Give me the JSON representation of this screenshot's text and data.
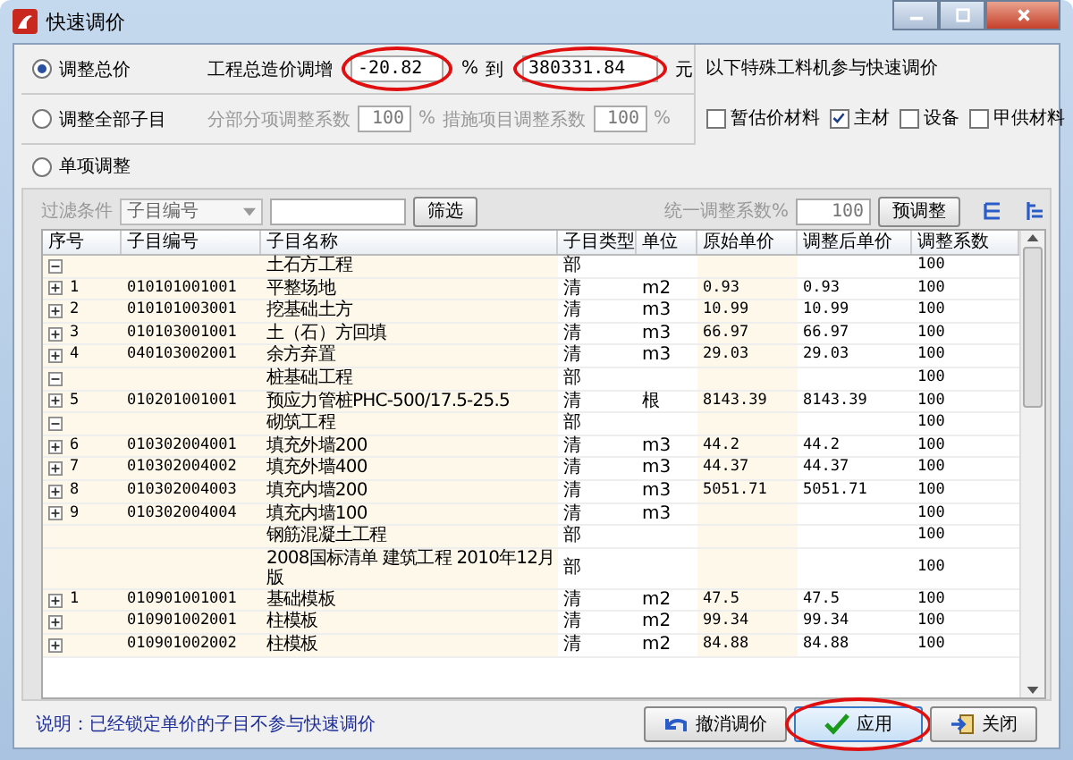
{
  "window": {
    "title": "快速调价"
  },
  "adjust_modes": [
    {
      "label": "调整总价",
      "selected": true
    },
    {
      "label": "调整全部子目",
      "selected": false
    },
    {
      "label": "单项调整",
      "selected": false
    }
  ],
  "total_adjust": {
    "label": "工程总造价调增",
    "percent": "-20.82",
    "percent_circled": true,
    "percent_unit": "%",
    "to_label": "到",
    "amount": "380331.84",
    "amount_circled": true,
    "amount_unit": "元"
  },
  "coef": {
    "disabled": true,
    "fenbu_label": "分部分项调整系数",
    "fenbu_value": "100",
    "fenbu_unit": "%",
    "cuoshi_label": "措施项目调整系数",
    "cuoshi_value": "100",
    "cuoshi_unit": "%"
  },
  "special": {
    "title": "以下特殊工料机参与快速调价",
    "options": [
      {
        "label": "暂估价材料",
        "checked": false
      },
      {
        "label": "主材",
        "checked": true
      },
      {
        "label": "设备",
        "checked": false
      },
      {
        "label": "甲供材料",
        "checked": false
      }
    ]
  },
  "filter": {
    "disabled": true,
    "label": "过滤条件",
    "field": "子目编号",
    "button": "筛选",
    "coef_label": "统一调整系数%",
    "coef_value": "100",
    "preadjust_button": "预调整"
  },
  "table": {
    "columns": [
      "序号",
      "子目编号",
      "子目名称",
      "子目类型",
      "单位",
      "原始单价",
      "调整后单价",
      "调整系数"
    ],
    "rows": [
      {
        "expanded": true,
        "no": "",
        "code": "",
        "name": "土石方工程",
        "type": "部",
        "unit": "",
        "orig": "",
        "adj": "",
        "coef": "100"
      },
      {
        "expanded": false,
        "no": "1",
        "code": "010101001001",
        "name": "平整场地",
        "type": "清",
        "unit": "m2",
        "orig": "0.93",
        "adj": "0.93",
        "coef": "100"
      },
      {
        "expanded": false,
        "no": "2",
        "code": "010101003001",
        "name": "挖基础土方",
        "type": "清",
        "unit": "m3",
        "orig": "10.99",
        "adj": "10.99",
        "coef": "100"
      },
      {
        "expanded": false,
        "no": "3",
        "code": "010103001001",
        "name": "土（石）方回填",
        "type": "清",
        "unit": "m3",
        "orig": "66.97",
        "adj": "66.97",
        "coef": "100"
      },
      {
        "expanded": false,
        "no": "4",
        "code": "040103002001",
        "name": "余方弃置",
        "type": "清",
        "unit": "m3",
        "orig": "29.03",
        "adj": "29.03",
        "coef": "100"
      },
      {
        "expanded": true,
        "no": "",
        "code": "",
        "name": "桩基础工程",
        "type": "部",
        "unit": "",
        "orig": "",
        "adj": "",
        "coef": "100"
      },
      {
        "expanded": false,
        "no": "5",
        "code": "010201001001",
        "name": "预应力管桩PHC-500/17.5-25.5",
        "type": "清",
        "unit": "根",
        "orig": "8143.39",
        "adj": "8143.39",
        "coef": "100"
      },
      {
        "expanded": true,
        "no": "",
        "code": "",
        "name": "砌筑工程",
        "type": "部",
        "unit": "",
        "orig": "",
        "adj": "",
        "coef": "100"
      },
      {
        "expanded": false,
        "no": "6",
        "code": "010302004001",
        "name": "填充外墙200",
        "type": "清",
        "unit": "m3",
        "orig": "44.2",
        "adj": "44.2",
        "coef": "100"
      },
      {
        "expanded": false,
        "no": "7",
        "code": "010302004002",
        "name": "填充外墙400",
        "type": "清",
        "unit": "m3",
        "orig": "44.37",
        "adj": "44.37",
        "coef": "100"
      },
      {
        "expanded": false,
        "no": "8",
        "code": "010302004003",
        "name": "填充内墙200",
        "type": "清",
        "unit": "m3",
        "orig": "5051.71",
        "adj": "5051.71",
        "coef": "100"
      },
      {
        "expanded": false,
        "no": "9",
        "code": "010302004004",
        "name": "填充内墙100",
        "type": "清",
        "unit": "m3",
        "orig": "",
        "adj": "",
        "coef": "100"
      },
      {
        "no": "",
        "code": "",
        "name": "钢筋混凝土工程",
        "type": "部",
        "unit": "",
        "orig": "",
        "adj": "",
        "coef": "100"
      },
      {
        "no": "",
        "code": "",
        "name": "2008国标清单 建筑工程 2010年12月版",
        "type": "部",
        "unit": "",
        "orig": "",
        "adj": "",
        "coef": "100"
      },
      {
        "expanded": false,
        "no": "1",
        "code": "010901001001",
        "name": "基础模板",
        "type": "清",
        "unit": "m2",
        "orig": "47.5",
        "adj": "47.5",
        "coef": "100"
      },
      {
        "expanded": false,
        "no": "",
        "code": "010901002001",
        "name": "柱模板",
        "type": "清",
        "unit": "m2",
        "orig": "99.34",
        "adj": "99.34",
        "coef": "100"
      },
      {
        "expanded": false,
        "no": "",
        "code": "010901002002",
        "name": "柱模板",
        "type": "清",
        "unit": "m2",
        "orig": "84.88",
        "adj": "84.88",
        "coef": "100"
      }
    ]
  },
  "note": "说明：已经锁定单价的子目不参与快速调价",
  "buttons": [
    {
      "label": "撤消调价",
      "kind": "undo",
      "circled": false
    },
    {
      "label": "应用",
      "kind": "apply",
      "circled": true
    },
    {
      "label": "关闭",
      "kind": "close",
      "circled": false
    }
  ]
}
